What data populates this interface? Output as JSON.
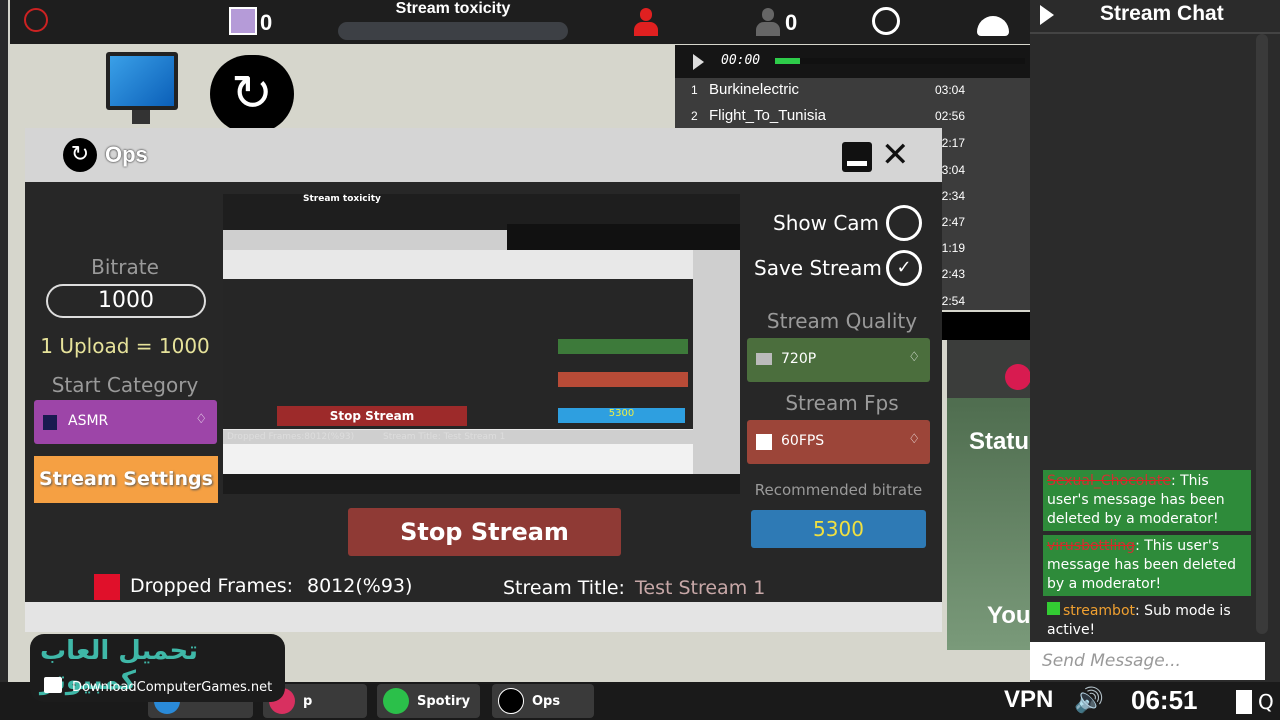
{
  "topbar": {
    "cat_count": "0",
    "toxicity_label": "Stream toxicity",
    "toxicity_level": 0,
    "viewers_count": "0"
  },
  "desktop": {
    "icons": [
      "computer-icon",
      "ops-app-icon"
    ]
  },
  "player": {
    "time": "00:00",
    "progress": 0.1,
    "songs": [
      {
        "n": "1",
        "title": "Burkinelectric",
        "dur": "03:04"
      },
      {
        "n": "2",
        "title": "Flight_To_Tunisia",
        "dur": "02:56"
      },
      {
        "dur": "2:17"
      },
      {
        "dur": "3:04"
      },
      {
        "dur": "2:34"
      },
      {
        "dur": "2:47"
      },
      {
        "dur": "1:19"
      },
      {
        "dur": "2:43"
      },
      {
        "dur": "2:54"
      }
    ]
  },
  "chat": {
    "title": "Stream Chat",
    "messages": [
      {
        "user": "Sexual_Chocolate",
        "text": ": This user's message has been deleted by a moderator!"
      },
      {
        "user": "virusbottling",
        "text": ": This user's message has been deleted by a moderator!"
      },
      {
        "user": "streambot",
        "text": ": Sub mode is active!"
      }
    ],
    "placeholder": "Send Message..."
  },
  "status_window": {
    "title": "Status",
    "text": "You"
  },
  "ops": {
    "title": "Ops",
    "bitrate_label": "Bitrate",
    "bitrate_value": "1000",
    "upload_text": "1 Upload = 1000",
    "category_label": "Start Category",
    "category_value": "ASMR",
    "settings_button": "Stream Settings",
    "show_cam": "Show Cam",
    "show_cam_checked": false,
    "save_stream": "Save Stream",
    "save_stream_checked": true,
    "quality_label": "Stream Quality",
    "quality_value": "720P",
    "fps_label": "Stream Fps",
    "fps_value": "60FPS",
    "rec_label": "Recommended bitrate",
    "rec_value": "5300",
    "stop_button": "Stop Stream",
    "dropped_label": "Dropped Frames:",
    "dropped_value": "8012(%93)",
    "title_label": "Stream Title:",
    "title_value": "Test Stream 1",
    "preview_texts": {
      "toxicity": "Stream toxicity",
      "stop": "Stop Stream",
      "title": "Stream Title: Test Stream 1",
      "rec": "5300",
      "dropped": "Dropped Frames:8012(%93)"
    }
  },
  "taskbar": {
    "apps": [
      {
        "label": "p"
      },
      {
        "label": "Spotiry"
      },
      {
        "label": "Ops"
      }
    ],
    "vpn": "VPN",
    "clock": "06:51"
  },
  "watermark": {
    "arabic": "تحميل العاب كمبيوتر",
    "site": "DownloadComputerGames.net"
  },
  "colors": {
    "purple": "#9d45a8",
    "orange": "#f5a043",
    "green": "#4b6e3d",
    "red": "#9c4539",
    "blue": "#2e7ab5",
    "stop": "#8f3a35"
  }
}
